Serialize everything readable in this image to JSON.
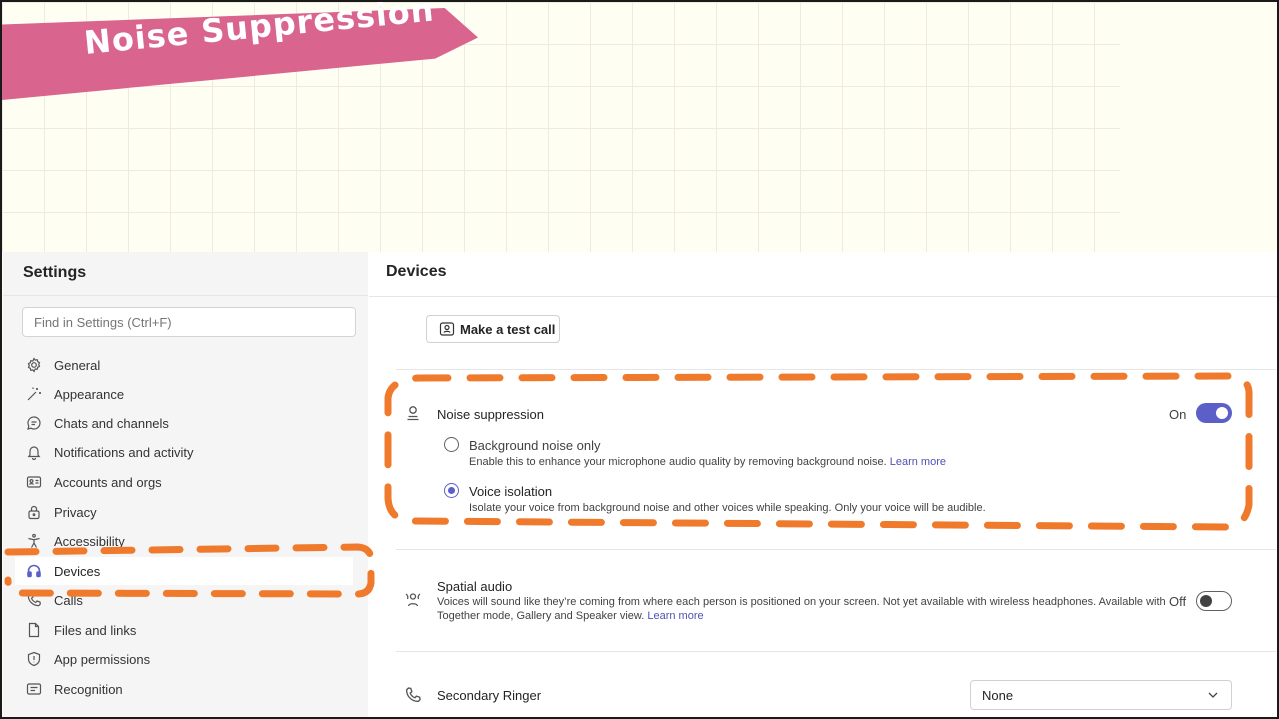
{
  "banner": {
    "title": "Noise Suppression"
  },
  "sidebar": {
    "title": "Settings",
    "search_placeholder": "Find in Settings (Ctrl+F)",
    "items": [
      {
        "label": "General",
        "icon": "gear-icon"
      },
      {
        "label": "Appearance",
        "icon": "wand-icon"
      },
      {
        "label": "Chats and channels",
        "icon": "chat-icon"
      },
      {
        "label": "Notifications and activity",
        "icon": "bell-icon"
      },
      {
        "label": "Accounts and orgs",
        "icon": "id-card-icon"
      },
      {
        "label": "Privacy",
        "icon": "lock-icon"
      },
      {
        "label": "Accessibility",
        "icon": "accessibility-icon"
      },
      {
        "label": "Devices",
        "icon": "headset-icon",
        "active": true
      },
      {
        "label": "Calls",
        "icon": "phone-icon"
      },
      {
        "label": "Files and links",
        "icon": "file-icon"
      },
      {
        "label": "App permissions",
        "icon": "shield-icon"
      },
      {
        "label": "Recognition",
        "icon": "recognition-icon"
      }
    ]
  },
  "main": {
    "title": "Devices",
    "test_call_label": "Make a test call",
    "noise": {
      "label": "Noise suppression",
      "state_label": "On",
      "enabled": true,
      "options": [
        {
          "label": "Background noise only",
          "description": "Enable this to enhance your microphone audio quality by removing background noise.",
          "link": "Learn more",
          "selected": false
        },
        {
          "label": "Voice isolation",
          "description": "Isolate your voice from background noise and other voices while speaking. Only your voice will be audible.",
          "selected": true
        }
      ]
    },
    "spatial": {
      "label": "Spatial audio",
      "description_line1": "Voices will sound like they’re coming from where each person is positioned on your screen. Not yet available with wireless headphones. Available with",
      "description_line2": "Together mode, Gallery and Speaker view.",
      "link": "Learn more",
      "state_label": "Off",
      "enabled": false
    },
    "ringer": {
      "label": "Secondary Ringer",
      "value": "None"
    }
  },
  "colors": {
    "accent": "#5b5fc7",
    "banner": "#d9648d",
    "annotation": "#f07a2c"
  }
}
